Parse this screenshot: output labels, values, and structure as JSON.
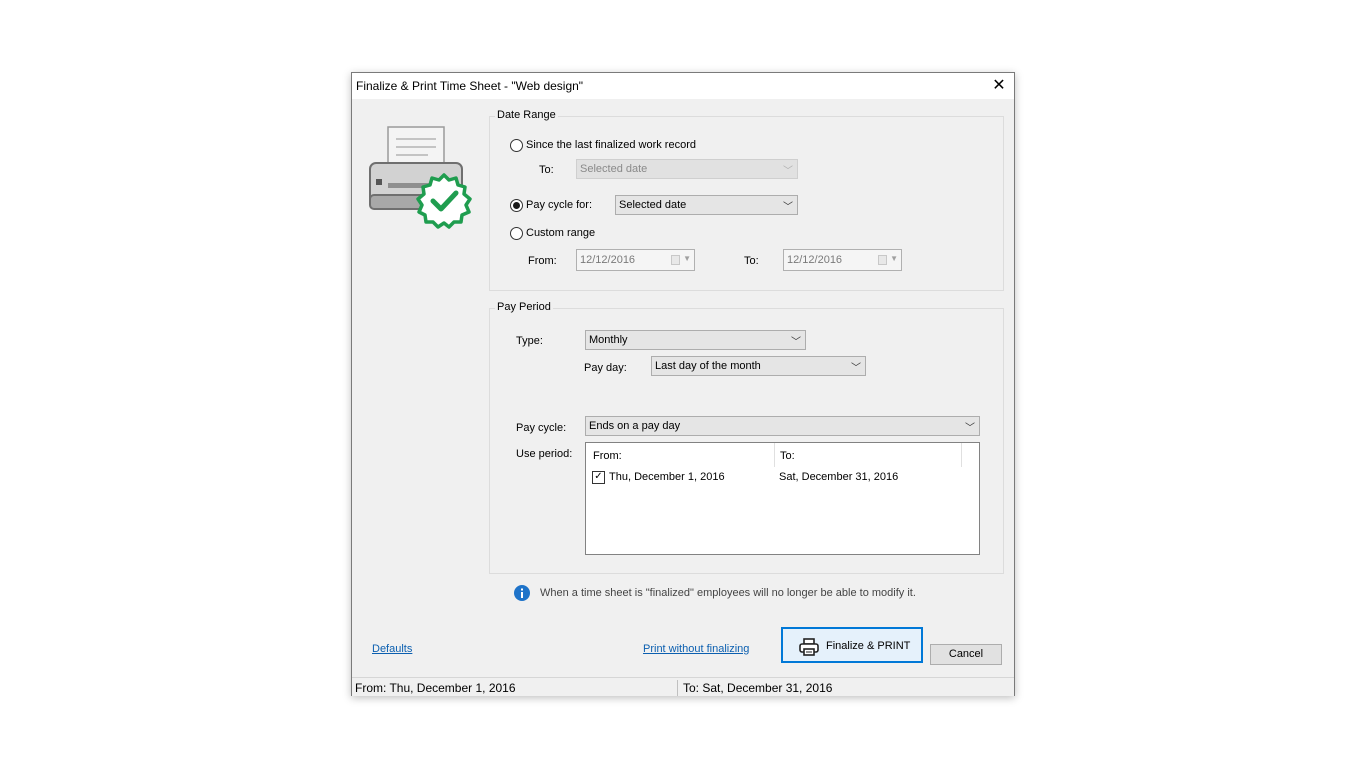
{
  "dialog": {
    "title": "Finalize & Print Time Sheet - \"Web design\"",
    "close_glyph": "✕"
  },
  "date_range": {
    "legend": "Date Range",
    "option_since_label": "Since the last finalized work record",
    "to_label": "To:",
    "to_value": "Selected date",
    "option_paycycle_label": "Pay cycle for:",
    "paycycle_value": "Selected date",
    "option_custom_label": "Custom range",
    "from_label": "From:",
    "from_date": "12/12/2016",
    "to2_label": "To:",
    "to_date": "12/12/2016",
    "selected_option": "Pay cycle for:"
  },
  "pay_period": {
    "legend": "Pay Period",
    "type_label": "Type:",
    "type_value": "Monthly",
    "pay_day_label": "Pay day:",
    "pay_day_value": "Last day of the month",
    "pay_cycle_label": "Pay cycle:",
    "pay_cycle_value": "Ends on a pay day",
    "use_period_label": "Use period:",
    "columns": [
      "From:",
      "To:"
    ],
    "rows": [
      {
        "checked": true,
        "from": "Thu, December 1, 2016",
        "to": "Sat, December 31, 2016"
      }
    ]
  },
  "info_text": "When a time sheet is \"finalized\" employees will no longer be able to modify it.",
  "footer": {
    "defaults_link": "Defaults",
    "print_without_link": "Print without finalizing",
    "finalize_button": "Finalize & PRINT",
    "cancel_button": "Cancel"
  },
  "statusbar": {
    "from": "From: Thu, December 1, 2016",
    "to": "To: Sat, December 31, 2016"
  },
  "icons": {
    "printer": "printer-icon",
    "badge": "green-check-badge",
    "info": "info-icon",
    "print_button": "printer-small-icon"
  },
  "colors": {
    "check_green": "#1f9d4f",
    "info_blue": "#1e73c9",
    "link_blue": "#0b5fb0",
    "focus_blue": "#0078d7"
  }
}
